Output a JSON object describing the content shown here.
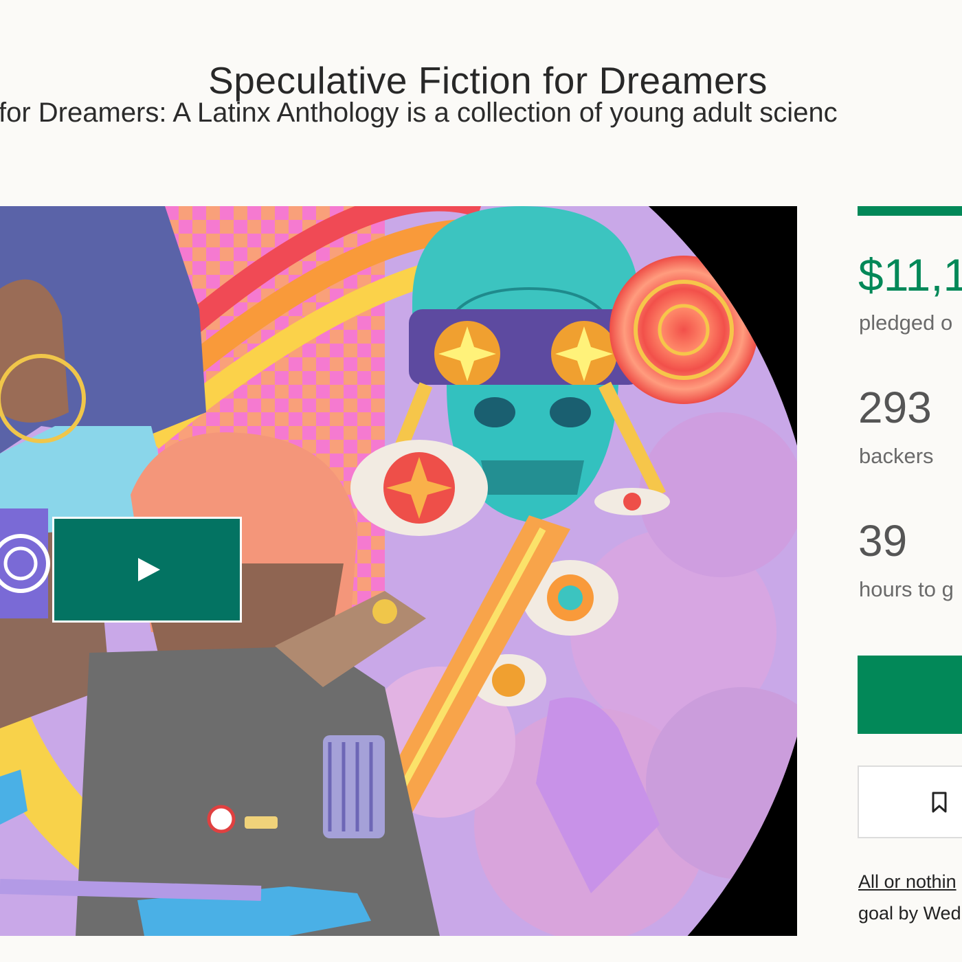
{
  "project": {
    "title": "Speculative Fiction for Dreamers",
    "blurb": "for Dreamers: A Latinx Anthology is a collection of young adult scienc"
  },
  "media": {
    "play_icon": "play-icon"
  },
  "stats": {
    "funding_progress": 1.0,
    "pledged_amount": "$11,1",
    "pledged_label": "pledged o",
    "backers_count": "293",
    "backers_label": "backers",
    "hours_count": "39",
    "hours_label": "hours to g"
  },
  "actions": {
    "remind_icon": "bookmark-icon"
  },
  "funding_terms": {
    "link": "All or nothin",
    "goal_text": "goal by Wed"
  },
  "colors": {
    "accent_green": "#028858",
    "play_button": "#037362"
  }
}
